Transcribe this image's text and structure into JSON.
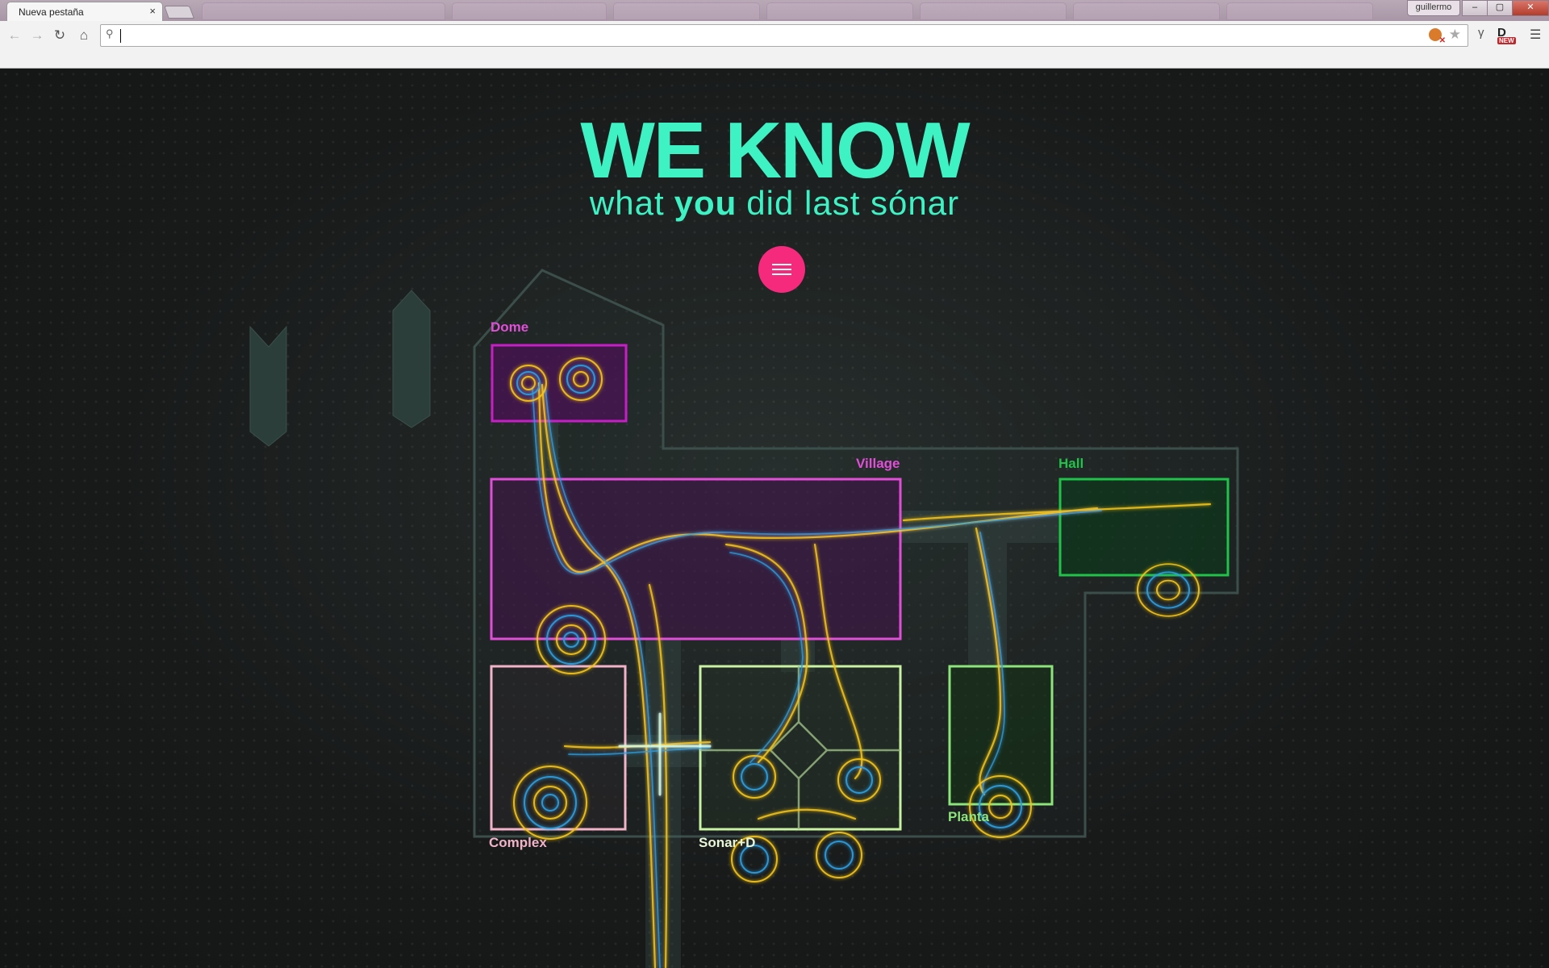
{
  "browser": {
    "tab_title": "Nueva pestaña",
    "tab_close": "×",
    "profile_name": "guillermo",
    "window_buttons": [
      "–",
      "▢",
      "✕"
    ],
    "new_badge": "NEW",
    "extension_letter": "D"
  },
  "hero": {
    "title": "WE KNOW",
    "sub_before": "what",
    "sub_emph": "you",
    "sub_after": "did last sónar"
  },
  "rooms": {
    "dome": "Dome",
    "village": "Village",
    "hall": "Hall",
    "complex": "Complex",
    "sonar_d": "Sonar+D",
    "planta": "Planta"
  },
  "colors": {
    "accent": "#3ef2c4",
    "menu_button": "#f52a7d",
    "dome": "#c51fc5",
    "village": "#e14fd9",
    "hall": "#20c24a",
    "complex": "#f2b3c9",
    "sonar_d": "#c9f2a3",
    "planta": "#8ce47a",
    "trail_yellow": "#f5c518",
    "trail_blue": "#2e9fe0"
  }
}
